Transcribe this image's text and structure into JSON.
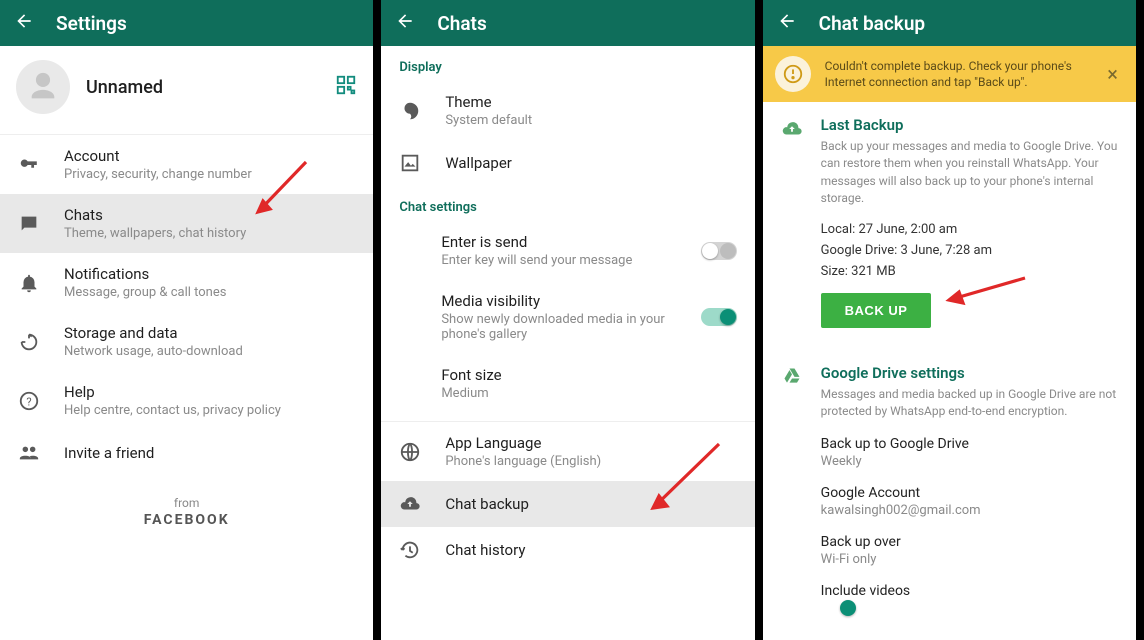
{
  "panel1": {
    "title": "Settings",
    "profile_name": "Unnamed",
    "items": [
      {
        "title": "Account",
        "subtitle": "Privacy, security, change number"
      },
      {
        "title": "Chats",
        "subtitle": "Theme, wallpapers, chat history"
      },
      {
        "title": "Notifications",
        "subtitle": "Message, group & call tones"
      },
      {
        "title": "Storage and data",
        "subtitle": "Network usage, auto-download"
      },
      {
        "title": "Help",
        "subtitle": "Help centre, contact us, privacy policy"
      },
      {
        "title": "Invite a friend",
        "subtitle": ""
      }
    ],
    "footer_from": "from",
    "footer_company": "FACEBOOK"
  },
  "panel2": {
    "title": "Chats",
    "section_display": "Display",
    "theme_title": "Theme",
    "theme_sub": "System default",
    "wallpaper_title": "Wallpaper",
    "section_chatsettings": "Chat settings",
    "enter_title": "Enter is send",
    "enter_sub": "Enter key will send your message",
    "media_title": "Media visibility",
    "media_sub": "Show newly downloaded media in your phone's gallery",
    "font_title": "Font size",
    "font_sub": "Medium",
    "lang_title": "App Language",
    "lang_sub": "Phone's language (English)",
    "chat_backup_title": "Chat backup",
    "chat_history_title": "Chat history"
  },
  "panel3": {
    "title": "Chat backup",
    "banner_text": "Couldn't complete backup. Check your phone's Internet connection and tap \"Back up\".",
    "last_backup_head": "Last Backup",
    "last_backup_desc": "Back up your messages and media to Google Drive. You can restore them when you reinstall WhatsApp. Your messages will also back up to your phone's internal storage.",
    "info_local": "Local: 27 June, 2:00 am",
    "info_drive": "Google Drive: 3 June, 7:28 am",
    "info_size": "Size: 321 MB",
    "backup_btn": "BACK UP",
    "gd_head": "Google Drive settings",
    "gd_desc": "Messages and media backed up in Google Drive are not protected by WhatsApp end-to-end encryption.",
    "opt_backup_to": "Back up to Google Drive",
    "opt_backup_to_val": "Weekly",
    "opt_account": "Google Account",
    "opt_account_val": "kawalsingh002@gmail.com",
    "opt_over": "Back up over",
    "opt_over_val": "Wi-Fi only",
    "opt_videos": "Include videos"
  }
}
